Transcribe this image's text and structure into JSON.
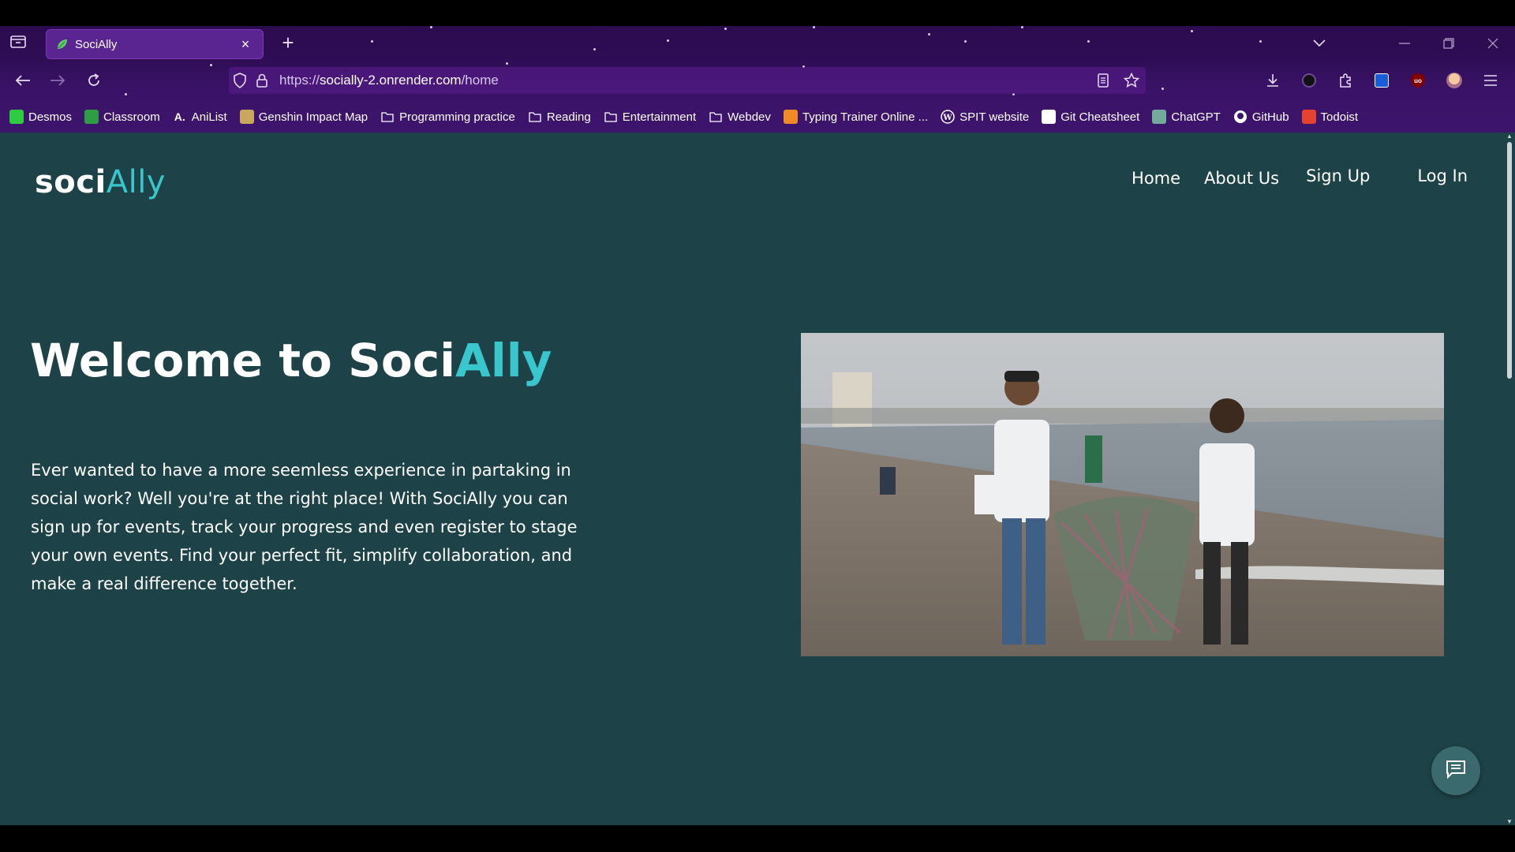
{
  "browser": {
    "tab": {
      "title": "SociAlly"
    },
    "url": {
      "scheme": "https://",
      "host": "socially-2.onrender.com",
      "path": "/home"
    },
    "bookmarks": [
      {
        "label": "Desmos",
        "icon": "desmos-icon",
        "color": "#2ecc40"
      },
      {
        "label": "Classroom",
        "icon": "classroom-icon",
        "color": "#2e9e44"
      },
      {
        "label": "AniList",
        "icon": "anilist-icon",
        "color": "#ffffff"
      },
      {
        "label": "Genshin Impact Map",
        "icon": "genshin-icon",
        "color": "#c9a75e"
      },
      {
        "label": "Programming practice",
        "icon": "folder-icon",
        "color": "#ffffff"
      },
      {
        "label": "Reading",
        "icon": "folder-icon",
        "color": "#ffffff"
      },
      {
        "label": "Entertainment",
        "icon": "folder-icon",
        "color": "#ffffff"
      },
      {
        "label": "Webdev",
        "icon": "folder-icon",
        "color": "#ffffff"
      },
      {
        "label": "Typing Trainer Online ...",
        "icon": "typing-icon",
        "color": "#f08a24"
      },
      {
        "label": "SPIT website",
        "icon": "wordpress-icon",
        "color": "#ffffff"
      },
      {
        "label": "Git Cheatsheet",
        "icon": "git-icon",
        "color": "#ffffff"
      },
      {
        "label": "ChatGPT",
        "icon": "chatgpt-icon",
        "color": "#74aa9c"
      },
      {
        "label": "GitHub",
        "icon": "github-icon",
        "color": "#ffffff"
      },
      {
        "label": "Todoist",
        "icon": "todoist-icon",
        "color": "#e44332"
      }
    ]
  },
  "site": {
    "logo": {
      "main": "soci",
      "accent": "Ally"
    },
    "nav": {
      "home": "Home",
      "about": "About Us",
      "signup": "Sign Up",
      "login": "Log In"
    },
    "hero": {
      "title_main": "Welcome to Soci",
      "title_accent": "Ally",
      "description": "Ever wanted to have a more seemless experience in partaking in social work? Well you're at the right place! With SociAlly you can sign up for events, track your progress and even register to stage your own events. Find your perfect fit, simplify collaboration, and make a real difference together."
    }
  },
  "colors": {
    "page_bg": "#1d4247",
    "accent": "#39c6cc",
    "browser_chrome": "#2f0d55"
  }
}
